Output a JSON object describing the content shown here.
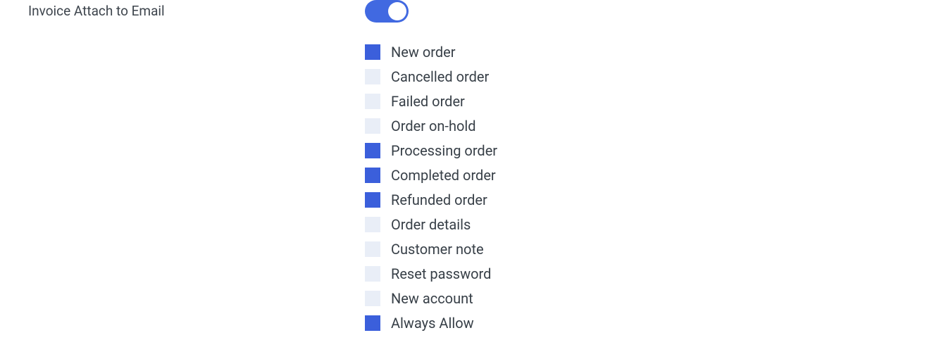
{
  "setting": {
    "label": "Invoice Attach to Email",
    "toggle_on": true,
    "options": [
      {
        "label": "New order",
        "checked": true
      },
      {
        "label": "Cancelled order",
        "checked": false
      },
      {
        "label": "Failed order",
        "checked": false
      },
      {
        "label": "Order on-hold",
        "checked": false
      },
      {
        "label": "Processing order",
        "checked": true
      },
      {
        "label": "Completed order",
        "checked": true
      },
      {
        "label": "Refunded order",
        "checked": true
      },
      {
        "label": "Order details",
        "checked": false
      },
      {
        "label": "Customer note",
        "checked": false
      },
      {
        "label": "Reset password",
        "checked": false
      },
      {
        "label": "New account",
        "checked": false
      },
      {
        "label": "Always Allow",
        "checked": true
      }
    ]
  }
}
